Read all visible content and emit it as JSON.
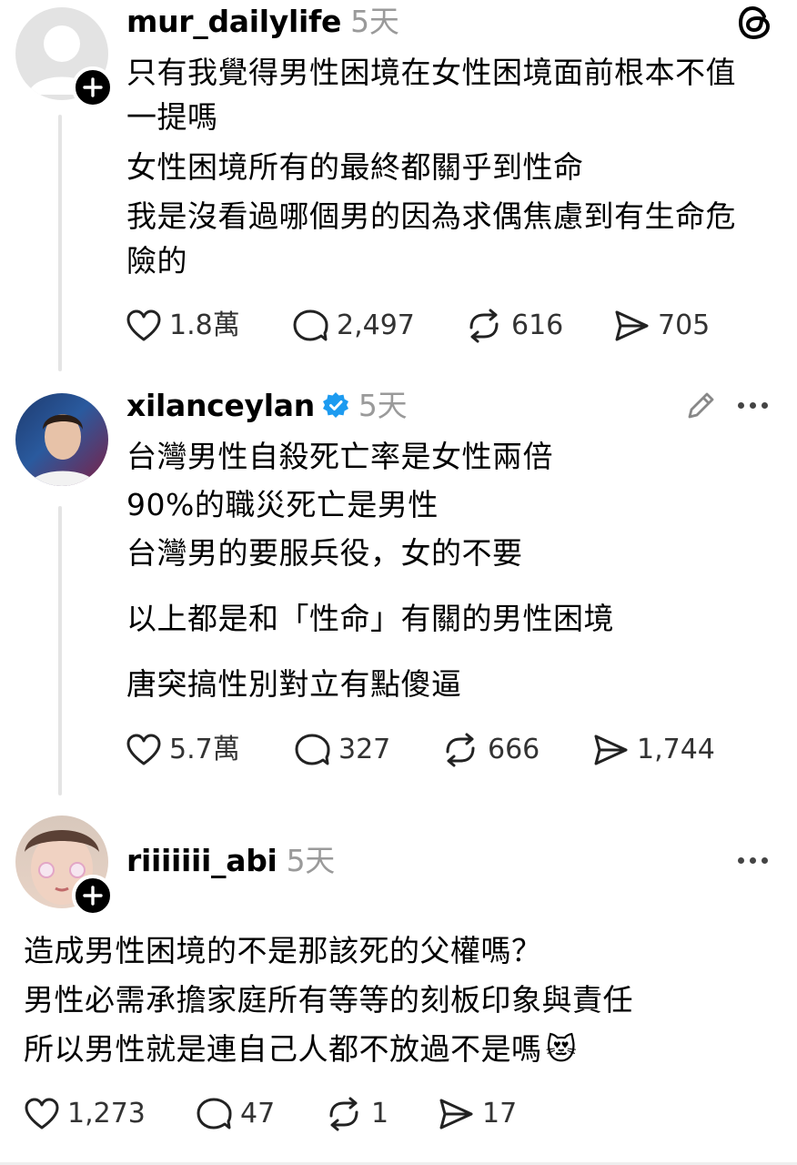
{
  "posts": [
    {
      "username": "mur_dailylife",
      "time": "5天",
      "lines": [
        "只有我覺得男性困境在女性困境面前根本不值",
        "一提嗎",
        "女性困境所有的最終都關乎到性命",
        "我是沒看過哪個男的因為求偶焦慮到有生命危",
        "險的"
      ],
      "likes": "1.8萬",
      "replies": "2,497",
      "reposts": "616",
      "shares": "705"
    },
    {
      "username": "xilanceylan",
      "time": "5天",
      "verified": true,
      "lines": [
        "台灣男性自殺死亡率是女性兩倍",
        "90%的職災死亡是男性",
        "台灣男的要服兵役，女的不要",
        "以上都是和「性命」有關的男性困境",
        "唐突搞性別對立有點傻逼"
      ],
      "likes": "5.7萬",
      "replies": "327",
      "reposts": "666",
      "shares": "1,744"
    },
    {
      "username": "riiiiiii_abi",
      "time": "5天",
      "lines": [
        "造成男性困境的不是那該死的父權嗎？",
        "男性必需承擔家庭所有等等的刻板印象與責任",
        "所以男性就是連自己人都不放過不是嗎"
      ],
      "emoji": "😻",
      "likes": "1,273",
      "replies": "47",
      "reposts": "1",
      "shares": "17"
    }
  ],
  "icons": {
    "app_logo": "threads-logo-icon",
    "like": "heart-icon",
    "reply": "comment-bubble-icon",
    "repost": "repost-arrows-icon",
    "share": "send-icon",
    "more": "more-dots-icon",
    "edit": "pencil-icon",
    "verified": "verified-badge-icon",
    "follow": "plus-icon"
  },
  "colors": {
    "verified": "#1d9bf0",
    "muted_text": "#9a9a9a",
    "thread_line": "#e4e4e4"
  }
}
